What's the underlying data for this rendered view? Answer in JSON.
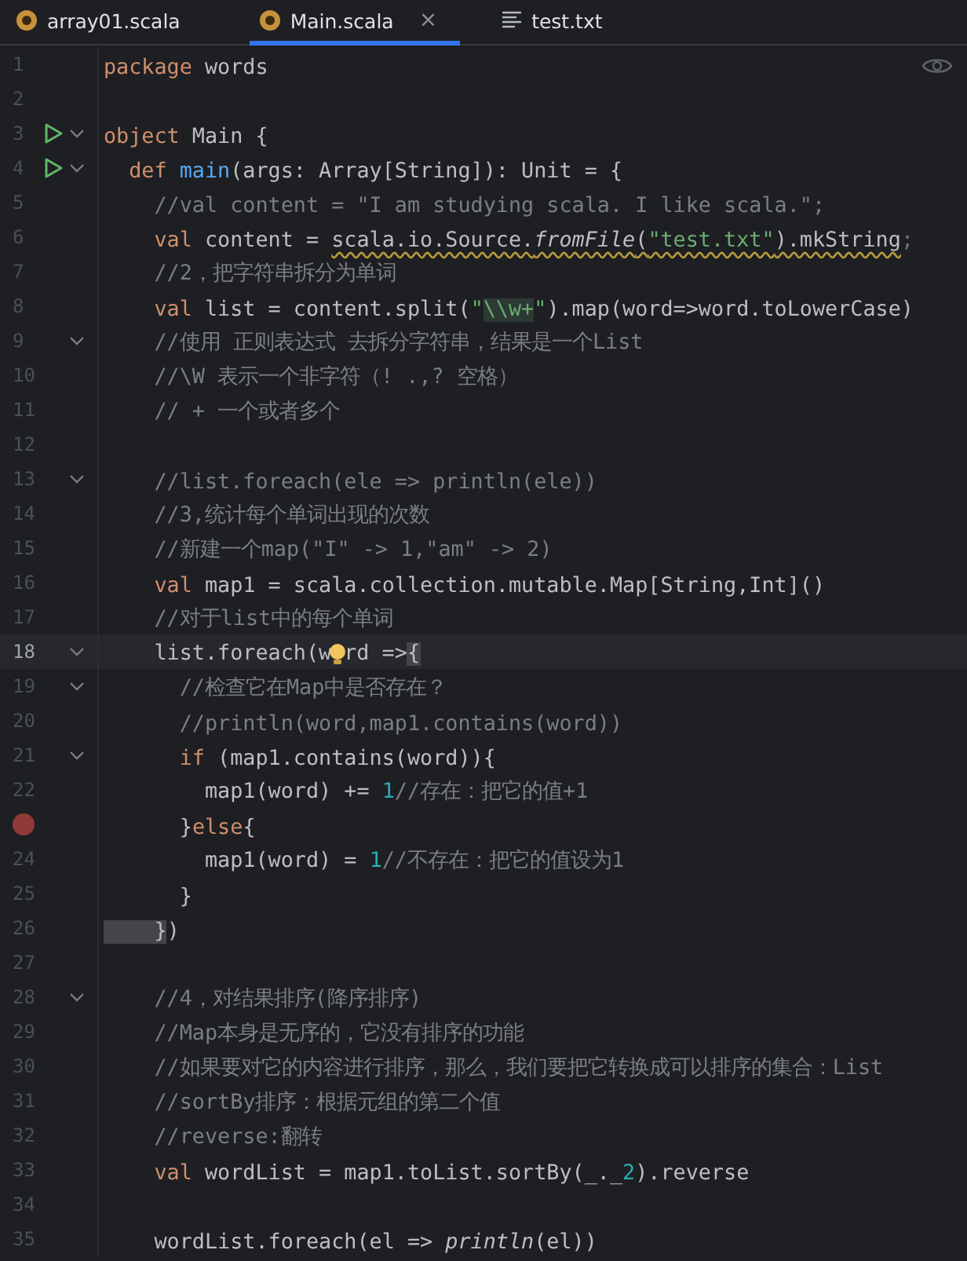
{
  "tabs": [
    {
      "label": "array01.scala",
      "kind": "scala",
      "selected": false,
      "closable": false
    },
    {
      "label": "Main.scala",
      "kind": "scala",
      "selected": true,
      "closable": true,
      "close": "×"
    },
    {
      "label": "test.txt",
      "kind": "text",
      "selected": false,
      "closable": false
    }
  ],
  "editor": {
    "lines": [
      {
        "number": "1",
        "selected": false,
        "run": false,
        "fold": false,
        "breakpoint": false,
        "segments": [
          {
            "text": "package",
            "kind": "kw"
          },
          {
            "text": " words",
            "kind": "plain"
          }
        ]
      },
      {
        "number": "2",
        "selected": false,
        "run": false,
        "fold": false,
        "breakpoint": false
      },
      {
        "number": "3",
        "selected": false,
        "run": true,
        "fold": true,
        "breakpoint": false,
        "segments": [
          {
            "text": "object",
            "kind": "kw"
          },
          {
            "text": " Main {",
            "kind": "plain"
          }
        ]
      },
      {
        "number": "4",
        "selected": false,
        "run": true,
        "fold": true,
        "breakpoint": false,
        "segments": [
          {
            "text": "  def",
            "kind": "kw"
          },
          {
            "text": " main",
            "kind": "fn"
          },
          {
            "text": "(args: Array[String]): Unit = {",
            "kind": "plain"
          }
        ]
      },
      {
        "number": "5",
        "selected": false,
        "run": false,
        "fold": false,
        "breakpoint": false,
        "segments": [
          {
            "text": "    //val content = \"I am studying scala. I like scala.\";",
            "kind": "comment"
          }
        ]
      },
      {
        "number": "6",
        "selected": false,
        "run": false,
        "fold": false,
        "breakpoint": false,
        "segments": [
          {
            "text": "    val",
            "kind": "kw"
          },
          {
            "text": " content = ",
            "kind": "plain"
          },
          {
            "kind": "squiggle",
            "children": [
              {
                "text": "scala.io.Source.",
                "kind": "plain"
              },
              {
                "text": "fromFile",
                "kind": "italic"
              },
              {
                "text": "(",
                "kind": "plain"
              },
              {
                "text": "\"test.txt\"",
                "kind": "string"
              },
              {
                "text": ").mkString",
                "kind": "plain"
              }
            ]
          },
          {
            "text": ";",
            "kind": "dim"
          }
        ]
      },
      {
        "number": "7",
        "selected": false,
        "run": false,
        "fold": false,
        "breakpoint": false,
        "segments": [
          {
            "text": "    //2，把字符串拆分为单词",
            "kind": "comment"
          }
        ]
      },
      {
        "number": "8",
        "selected": false,
        "run": false,
        "fold": false,
        "breakpoint": false,
        "segments": [
          {
            "text": "    val",
            "kind": "kw"
          },
          {
            "text": " list = content.split(",
            "kind": "plain"
          },
          {
            "text": "\"",
            "kind": "string"
          },
          {
            "text": "\\\\w+",
            "kind": "hl"
          },
          {
            "text": "\"",
            "kind": "string"
          },
          {
            "text": ").map(word=>word.toLowerCase)",
            "kind": "plain"
          }
        ]
      },
      {
        "number": "9",
        "selected": false,
        "run": false,
        "fold": true,
        "breakpoint": false,
        "segments": [
          {
            "text": "    //使用 正则表达式 去拆分字符串，结果是一个List",
            "kind": "comment"
          }
        ]
      },
      {
        "number": "10",
        "selected": false,
        "run": false,
        "fold": false,
        "breakpoint": false,
        "segments": [
          {
            "text": "    //\\W 表示一个非字符（! .,? 空格）",
            "kind": "comment"
          }
        ]
      },
      {
        "number": "11",
        "selected": false,
        "run": false,
        "fold": false,
        "breakpoint": false,
        "segments": [
          {
            "text": "    // + 一个或者多个",
            "kind": "comment"
          }
        ]
      },
      {
        "number": "12",
        "selected": false,
        "run": false,
        "fold": false,
        "breakpoint": false
      },
      {
        "number": "13",
        "selected": false,
        "run": false,
        "fold": true,
        "breakpoint": false,
        "segments": [
          {
            "text": "    //list.foreach(ele => println(ele))",
            "kind": "comment"
          }
        ]
      },
      {
        "number": "14",
        "selected": false,
        "run": false,
        "fold": false,
        "breakpoint": false,
        "segments": [
          {
            "text": "    //3,统计每个单词出现的次数",
            "kind": "comment"
          }
        ]
      },
      {
        "number": "15",
        "selected": false,
        "run": false,
        "fold": false,
        "breakpoint": false,
        "segments": [
          {
            "text": "    //新建一个map(\"I\" -> 1,\"am\" -> 2)",
            "kind": "comment"
          }
        ]
      },
      {
        "number": "16",
        "selected": false,
        "run": false,
        "fold": false,
        "breakpoint": false,
        "segments": [
          {
            "text": "    val",
            "kind": "kw"
          },
          {
            "text": " map1 = scala.collection.mutable.Map[String,Int]()",
            "kind": "plain"
          }
        ]
      },
      {
        "number": "17",
        "selected": false,
        "run": false,
        "fold": false,
        "breakpoint": false,
        "segments": [
          {
            "text": "    //对于list中的每个单词",
            "kind": "comment"
          }
        ]
      },
      {
        "number": "18",
        "selected": true,
        "run": false,
        "fold": true,
        "breakpoint": false,
        "segments": [
          {
            "text": "    list.foreach(w",
            "kind": "plain"
          },
          {
            "kind": "bulb"
          },
          {
            "text": "rd =>",
            "kind": "plain"
          },
          {
            "text": "{",
            "kind": "match"
          }
        ]
      },
      {
        "number": "19",
        "selected": false,
        "run": false,
        "fold": true,
        "breakpoint": false,
        "segments": [
          {
            "text": "      //检查它在Map中是否存在？",
            "kind": "comment"
          }
        ]
      },
      {
        "number": "20",
        "selected": false,
        "run": false,
        "fold": false,
        "breakpoint": false,
        "segments": [
          {
            "text": "      //println(word,map1.contains(word))",
            "kind": "comment"
          }
        ]
      },
      {
        "number": "21",
        "selected": false,
        "run": false,
        "fold": true,
        "breakpoint": false,
        "segments": [
          {
            "text": "      if",
            "kind": "kw"
          },
          {
            "text": " (map1.contains(word)){",
            "kind": "plain"
          }
        ]
      },
      {
        "number": "22",
        "selected": false,
        "run": false,
        "fold": false,
        "breakpoint": false,
        "segments": [
          {
            "text": "        map1(word) += ",
            "kind": "plain"
          },
          {
            "text": "1",
            "kind": "num"
          },
          {
            "text": "//存在：把它的值+1",
            "kind": "comment"
          }
        ]
      },
      {
        "selected": false,
        "run": false,
        "fold": false,
        "breakpoint": true,
        "segments": [
          {
            "text": "      }",
            "kind": "plain"
          },
          {
            "text": "else",
            "kind": "kw"
          },
          {
            "text": "{",
            "kind": "plain"
          }
        ]
      },
      {
        "number": "24",
        "selected": false,
        "run": false,
        "fold": false,
        "breakpoint": false,
        "segments": [
          {
            "text": "        map1(word) = ",
            "kind": "plain"
          },
          {
            "text": "1",
            "kind": "num"
          },
          {
            "text": "//不存在：把它的值设为1",
            "kind": "comment"
          }
        ]
      },
      {
        "number": "25",
        "selected": false,
        "run": false,
        "fold": false,
        "breakpoint": false,
        "segments": [
          {
            "text": "      }",
            "kind": "plain"
          }
        ]
      },
      {
        "number": "26",
        "selected": false,
        "run": false,
        "fold": false,
        "breakpoint": false,
        "segments": [
          {
            "text": "    }",
            "kind": "match"
          },
          {
            "text": ")",
            "kind": "plain"
          }
        ]
      },
      {
        "number": "27",
        "selected": false,
        "run": false,
        "fold": false,
        "breakpoint": false
      },
      {
        "number": "28",
        "selected": false,
        "run": false,
        "fold": true,
        "breakpoint": false,
        "segments": [
          {
            "text": "    //4，对结果排序(降序排序)",
            "kind": "comment"
          }
        ]
      },
      {
        "number": "29",
        "selected": false,
        "run": false,
        "fold": false,
        "breakpoint": false,
        "segments": [
          {
            "text": "    //Map本身是无序的，它没有排序的功能",
            "kind": "comment"
          }
        ]
      },
      {
        "number": "30",
        "selected": false,
        "run": false,
        "fold": false,
        "breakpoint": false,
        "segments": [
          {
            "text": "    //如果要对它的内容进行排序，那么，我们要把它转换成可以排序的集合：List",
            "kind": "comment"
          }
        ]
      },
      {
        "number": "31",
        "selected": false,
        "run": false,
        "fold": false,
        "breakpoint": false,
        "segments": [
          {
            "text": "    //sortBy排序：根据元组的第二个值",
            "kind": "comment"
          }
        ]
      },
      {
        "number": "32",
        "selected": false,
        "run": false,
        "fold": false,
        "breakpoint": false,
        "segments": [
          {
            "text": "    //reverse:翻转",
            "kind": "comment"
          }
        ]
      },
      {
        "number": "33",
        "selected": false,
        "run": false,
        "fold": false,
        "breakpoint": false,
        "segments": [
          {
            "text": "    val",
            "kind": "kw"
          },
          {
            "text": " wordList = map1.toList.sortBy(_._",
            "kind": "plain"
          },
          {
            "text": "2",
            "kind": "num"
          },
          {
            "text": ").reverse",
            "kind": "plain"
          }
        ]
      },
      {
        "number": "34",
        "selected": false,
        "run": false,
        "fold": false,
        "breakpoint": false
      },
      {
        "number": "35",
        "selected": false,
        "run": false,
        "fold": false,
        "breakpoint": false,
        "segments": [
          {
            "text": "    wordList.foreach(el => ",
            "kind": "plain"
          },
          {
            "text": "println",
            "kind": "italic"
          },
          {
            "text": "(el))",
            "kind": "plain"
          }
        ]
      }
    ]
  }
}
